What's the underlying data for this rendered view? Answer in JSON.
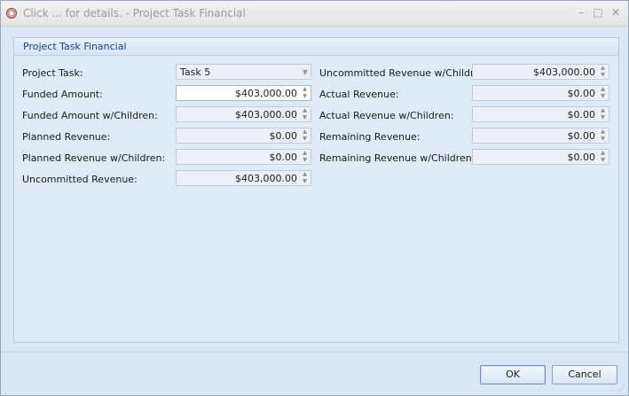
{
  "window": {
    "title": "Click ... for details. - Project Task Financial",
    "minimize_glyph": "–",
    "maximize_glyph": "□",
    "close_glyph": "✕"
  },
  "group": {
    "title": "Project Task Financial"
  },
  "left": [
    {
      "label": "Project Task:",
      "value": "Task 5",
      "kind": "dropdown"
    },
    {
      "label": "Funded Amount:",
      "value": "$403,000.00",
      "kind": "spin-editable"
    },
    {
      "label": "Funded Amount w/Children:",
      "value": "$403,000.00",
      "kind": "spin"
    },
    {
      "label": "Planned Revenue:",
      "value": "$0.00",
      "kind": "spin"
    },
    {
      "label": "Planned Revenue w/Children:",
      "value": "$0.00",
      "kind": "spin"
    },
    {
      "label": "Uncommitted Revenue:",
      "value": "$403,000.00",
      "kind": "spin"
    }
  ],
  "right": [
    {
      "label": "Uncommitted Revenue w/Children:",
      "value": "$403,000.00",
      "kind": "spin"
    },
    {
      "label": "Actual Revenue:",
      "value": "$0.00",
      "kind": "spin"
    },
    {
      "label": "Actual Revenue w/Children:",
      "value": "$0.00",
      "kind": "spin"
    },
    {
      "label": "Remaining Revenue:",
      "value": "$0.00",
      "kind": "spin"
    },
    {
      "label": "Remaining Revenue w/Children:",
      "value": "$0.00",
      "kind": "spin"
    }
  ],
  "buttons": {
    "ok": "OK",
    "cancel": "Cancel"
  },
  "colors": {
    "accent": "#15428b",
    "window_bg": "#dae6f5",
    "field_bg": "#ebf0f7"
  }
}
